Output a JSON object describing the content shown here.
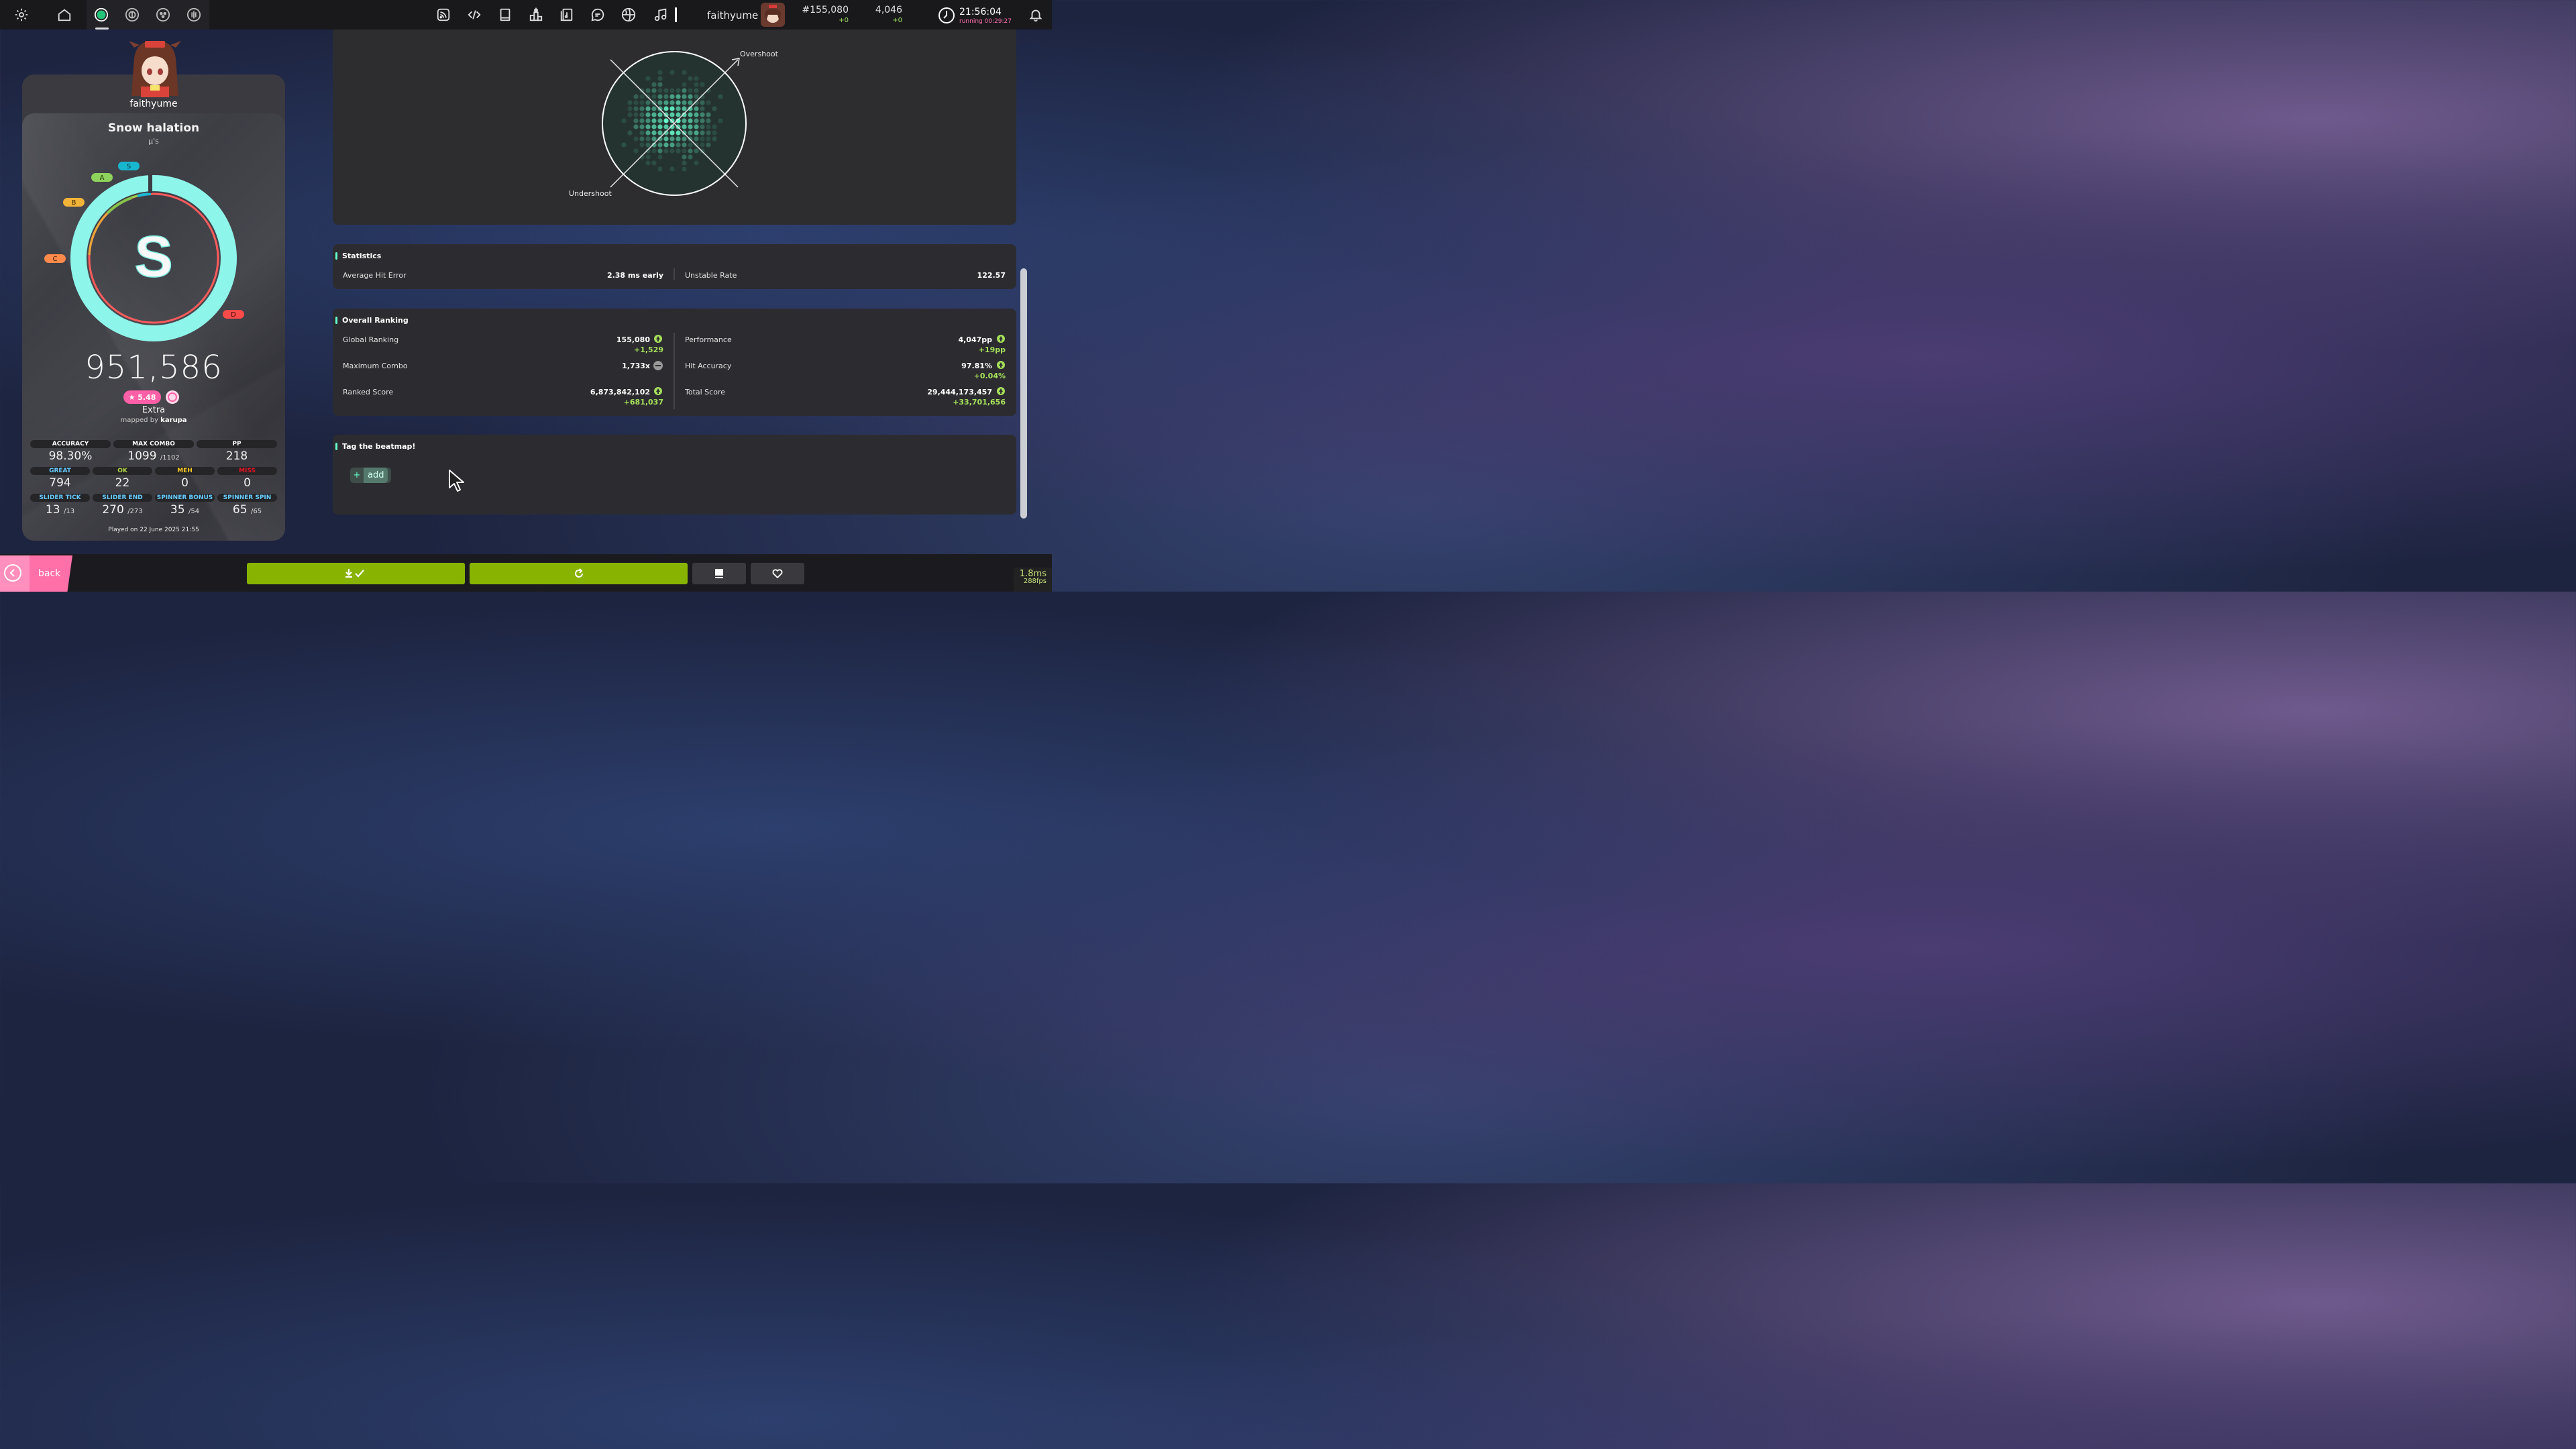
{
  "topbar": {
    "icons_left": [
      "settings-icon",
      "home-icon"
    ],
    "rulesets": [
      "osu-ruleset-icon",
      "taiko-ruleset-icon",
      "catch-ruleset-icon",
      "mania-ruleset-icon"
    ],
    "icons_center": [
      "rss-icon",
      "code-icon",
      "book-icon",
      "ranking-icon",
      "beatmap-listing-icon",
      "chat-icon",
      "globe-icon",
      "music-icon"
    ],
    "username": "faithyume",
    "rank": "#155,080",
    "rank_delta": "+0",
    "pp": "4,046",
    "pp_delta": "+0",
    "time": "21:56:04",
    "running": "running 00:29:27"
  },
  "player": {
    "name": "faithyume"
  },
  "song": {
    "title": "Snow halation",
    "artist": "μ's"
  },
  "rank": {
    "letter": "S",
    "grade_labels": [
      "S",
      "A",
      "B",
      "C",
      "D"
    ],
    "accuracy": 0.983
  },
  "score": "951,586",
  "difficulty": {
    "stars": "★ 5.48",
    "name": "Extra",
    "mapped_by_prefix": "mapped by",
    "mapper": "karupa"
  },
  "stats_row1": [
    {
      "label": "ACCURACY",
      "value": "98.30%",
      "sub": ""
    },
    {
      "label": "MAX COMBO",
      "value": "1099",
      "sub": "/1102"
    },
    {
      "label": "PP",
      "value": "218",
      "sub": ""
    }
  ],
  "stats_row2": [
    {
      "label": "GREAT",
      "value": "794",
      "color": "#66ccff"
    },
    {
      "label": "OK",
      "value": "22",
      "color": "#b3d944"
    },
    {
      "label": "MEH",
      "value": "0",
      "color": "#ffcc22"
    },
    {
      "label": "MISS",
      "value": "0",
      "color": "#ed1121"
    }
  ],
  "stats_row3": [
    {
      "label": "SLIDER TICK",
      "value": "13",
      "sub": "/13",
      "color": "#66ccff"
    },
    {
      "label": "SLIDER END",
      "value": "270",
      "sub": "/273",
      "color": "#66ccff"
    },
    {
      "label": "SPINNER BONUS",
      "value": "35",
      "sub": "/54",
      "color": "#66ccff"
    },
    {
      "label": "SPINNER SPIN",
      "value": "65",
      "sub": "/65",
      "color": "#66ccff"
    }
  ],
  "played_on": "Played on 22 June 2025 21:55",
  "hit_chart": {
    "overshoot": "Overshoot",
    "undershoot": "Undershoot"
  },
  "statistics": {
    "title": "Statistics",
    "average_hit_error_label": "Average Hit Error",
    "average_hit_error_value": "2.38 ms early",
    "unstable_rate_label": "Unstable Rate",
    "unstable_rate_value": "122.57"
  },
  "overall_ranking": {
    "title": "Overall Ranking",
    "global_ranking": {
      "label": "Global Ranking",
      "value": "155,080",
      "delta": "+1,529"
    },
    "maximum_combo": {
      "label": "Maximum Combo",
      "value": "1,733x"
    },
    "ranked_score": {
      "label": "Ranked Score",
      "value": "6,873,842,102",
      "delta": "+681,037"
    },
    "performance": {
      "label": "Performance",
      "value": "4,047pp",
      "delta": "+19pp"
    },
    "hit_accuracy": {
      "label": "Hit Accuracy",
      "value": "97.81%",
      "delta": "+0.04%"
    },
    "total_score": {
      "label": "Total Score",
      "value": "29,444,173,457",
      "delta": "+33,701,656"
    }
  },
  "tag": {
    "title": "Tag the beatmap!",
    "plus": "+",
    "add_label": "add"
  },
  "bottombar": {
    "back_label": "back",
    "buttons": [
      "download-check-icon",
      "replay-icon",
      "book-icon",
      "heart-icon"
    ]
  },
  "fps": {
    "ms": "1.8ms",
    "fps": "288fps"
  },
  "colors": {
    "accent": "#66ffcc",
    "pink": "#ff6fa8",
    "green": "#88b300",
    "ring_cyan": "#8ef5ea",
    "ring_red": "#ff5c5c"
  }
}
